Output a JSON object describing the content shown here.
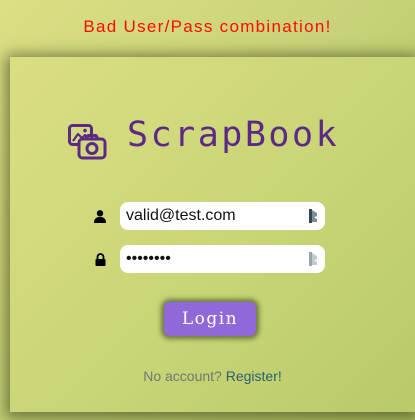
{
  "alert": {
    "error_message": "Bad User/Pass combination!"
  },
  "brand": {
    "name": "ScrapBook",
    "logo_icon": "photos-camera-icon"
  },
  "form": {
    "username": {
      "value": "valid@test.com",
      "icon": "user-icon"
    },
    "password": {
      "value": "••••••••",
      "icon": "lock-icon"
    },
    "password_manager_icon": "password-manager-icon",
    "login_label": "Login"
  },
  "footer": {
    "prompt": "No account?",
    "register_label": "Register!"
  },
  "colors": {
    "error": "#ff0a0a",
    "brand": "#5c2a86",
    "button": "#9168d8",
    "link": "#2b5f6f",
    "background": "#c8d278"
  }
}
